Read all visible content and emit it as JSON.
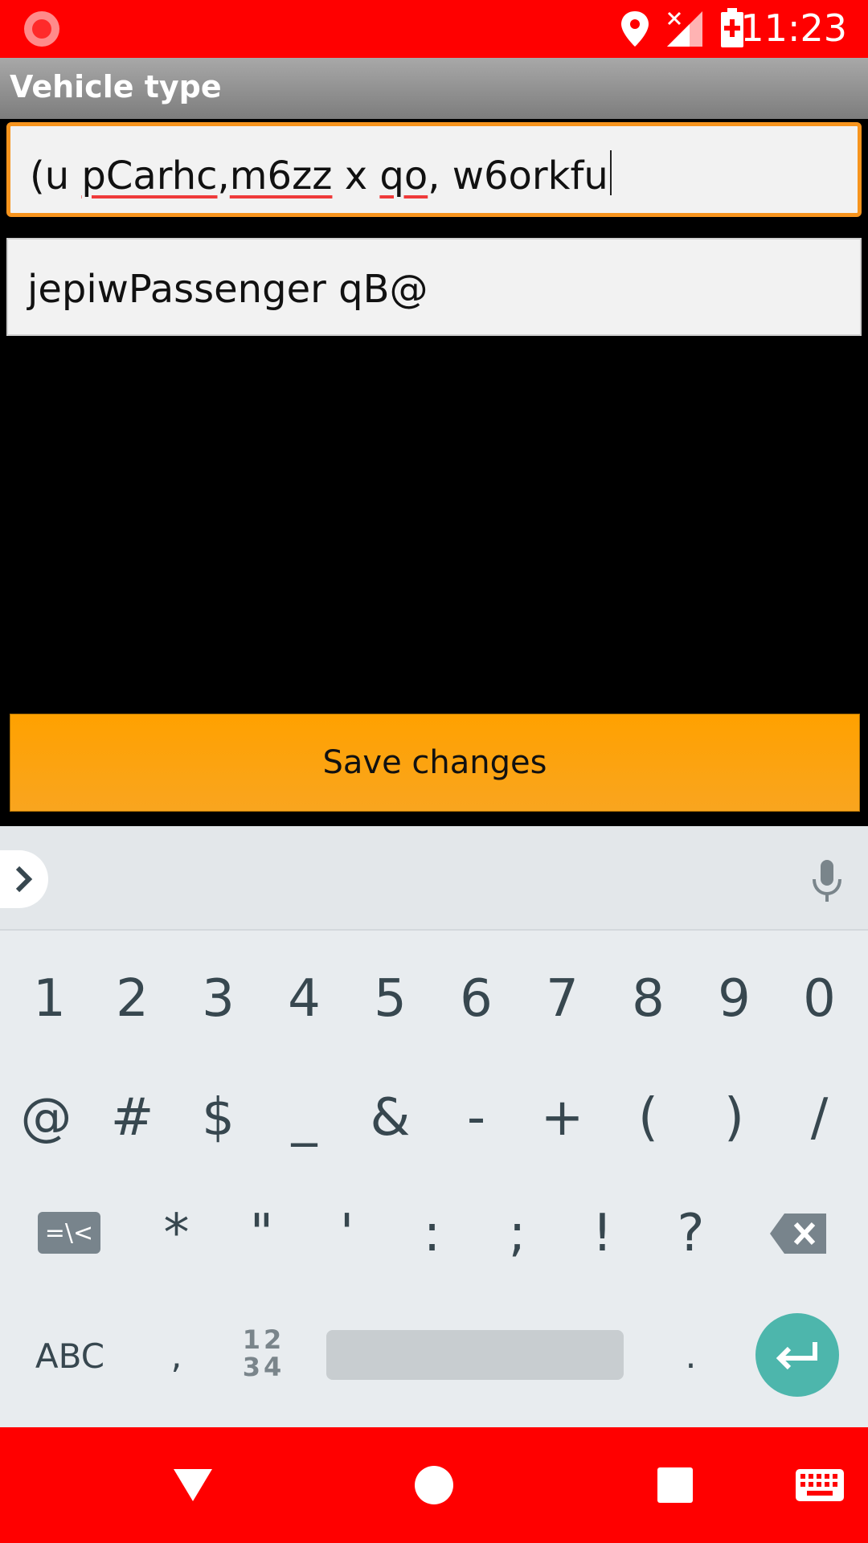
{
  "status_bar": {
    "time": "11:23",
    "icons": [
      "screen-record-icon",
      "location-icon",
      "signal-no-service-icon",
      "battery-charging-icon"
    ]
  },
  "titlebar": {
    "title": "Vehicle type"
  },
  "fields": {
    "field1": {
      "value_parts": [
        "(u ",
        "pCarhc",
        ",",
        "m6zz",
        " x ",
        "qo",
        ", w6orkfu"
      ],
      "focused": true
    },
    "field2": {
      "value": "jepiwPassenger qB@"
    }
  },
  "save_button": {
    "label": "Save changes"
  },
  "keyboard": {
    "row1": [
      "1",
      "2",
      "3",
      "4",
      "5",
      "6",
      "7",
      "8",
      "9",
      "0"
    ],
    "row2": [
      "@",
      "#",
      "$",
      "_",
      "&",
      "-",
      "+",
      "(",
      ")",
      "/"
    ],
    "row3_symbols_key": "=\\<",
    "row3": [
      "*",
      "\"",
      "'",
      ":",
      ";",
      "!",
      "?"
    ],
    "row4": {
      "abc": "ABC",
      "comma": ",",
      "num_top": "12",
      "num_bottom": "34",
      "period": "."
    }
  },
  "colors": {
    "status_bar": "#ff0000",
    "accent": "#f7941d",
    "save_button": "#ffa100",
    "enter_key": "#4db6ac"
  }
}
